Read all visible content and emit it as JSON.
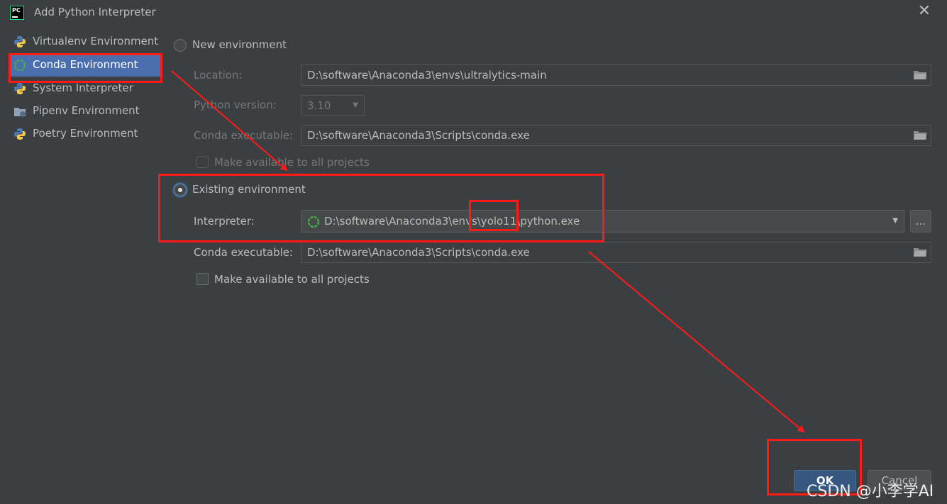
{
  "window": {
    "title": "Add Python Interpreter"
  },
  "sidebar": {
    "items": [
      {
        "label": "Virtualenv Environment",
        "icon": "python-icon"
      },
      {
        "label": "Conda Environment",
        "icon": "conda-icon",
        "selected": true
      },
      {
        "label": "System Interpreter",
        "icon": "python-icon"
      },
      {
        "label": "Pipenv Environment",
        "icon": "pipenv-icon"
      },
      {
        "label": "Poetry Environment",
        "icon": "python-icon"
      }
    ]
  },
  "new_env": {
    "radio_label": "New environment",
    "selected": false,
    "location_label": "Location:",
    "location_value": "D:\\software\\Anaconda3\\envs\\ultralytics-main",
    "python_version_label": "Python version:",
    "python_version_value": "3.10",
    "conda_exec_label": "Conda executable:",
    "conda_exec_value": "D:\\software\\Anaconda3\\Scripts\\conda.exe",
    "make_available_label": "Make available to all projects"
  },
  "existing_env": {
    "radio_label": "Existing environment",
    "selected": true,
    "interpreter_label": "Interpreter:",
    "interpreter_value": "D:\\software\\Anaconda3\\envs\\yolo11\\python.exe",
    "browse_label": "...",
    "conda_exec_label": "Conda executable:",
    "conda_exec_value": "D:\\software\\Anaconda3\\Scripts\\conda.exe",
    "make_available_label": "Make available to all projects",
    "make_available_checked": false
  },
  "buttons": {
    "ok": "OK",
    "cancel": "Cancel"
  },
  "watermark": "CSDN @小李学AI",
  "colors": {
    "background": "#3c3f41",
    "selection": "#4b6eaf",
    "annotation": "#ff1a1a",
    "primary_button": "#365880"
  }
}
